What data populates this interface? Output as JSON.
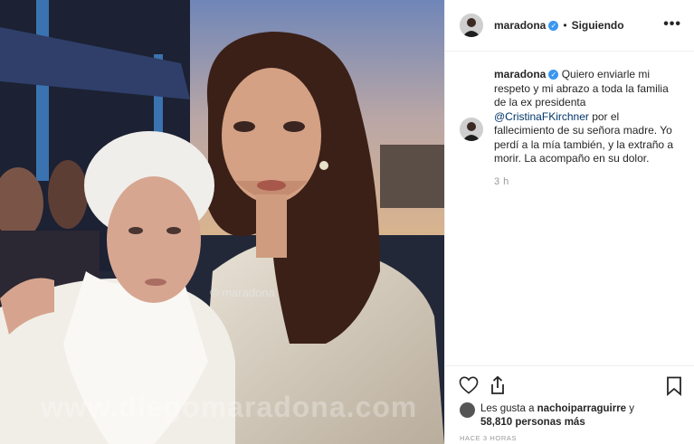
{
  "post": {
    "photo_watermark_small": "© maradona",
    "photo_watermark_big": "www.diegomaradona.com",
    "header": {
      "username": "maradona",
      "verified_glyph": "✓",
      "separator": "•",
      "follow_status": "Siguiendo",
      "more_glyph": "•••"
    },
    "comment": {
      "username": "maradona",
      "verified_glyph": "✓",
      "text_before": " Quiero enviarle mi respeto y mi abrazo a toda la familia de la ex presidenta ",
      "mention": "@CristinaFKirchner",
      "text_after": " por el fallecimiento de su señora madre. Yo perdí a la mía también, y la extraño a morir. La acompaño en su dolor.",
      "time": "3 h"
    },
    "actions": {
      "like_icon": "heart-icon",
      "share_icon": "share-icon",
      "save_icon": "bookmark-icon"
    },
    "likes": {
      "prefix": "Les gusta a ",
      "user": "nachoiparraguirre",
      "joiner": " y",
      "count": "58,810 personas más"
    },
    "posted_ago": "HACE 3 HORAS"
  }
}
